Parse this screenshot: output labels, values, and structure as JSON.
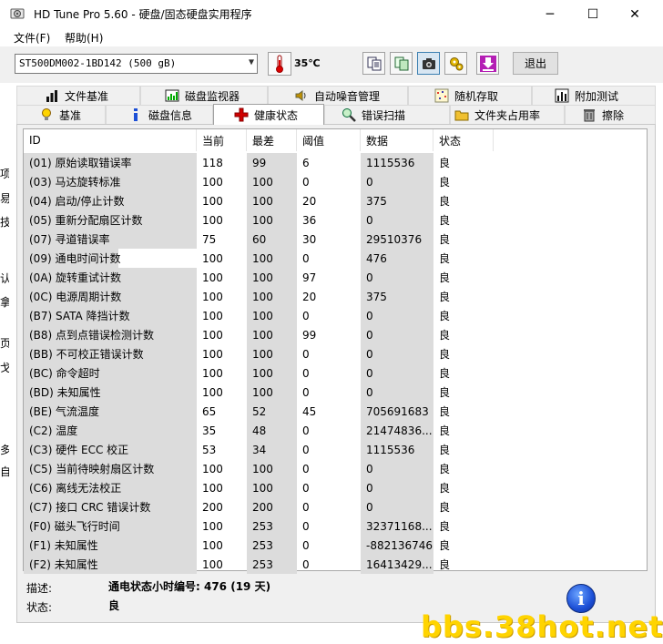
{
  "window": {
    "title": "HD Tune Pro 5.60 - 硬盘/固态硬盘实用程序",
    "minimize": "─",
    "maximize": "☐",
    "close": "✕"
  },
  "menu": [
    "文件(F)",
    "帮助(H)"
  ],
  "toolbar": {
    "drive": "ST500DM002-1BD142 (500 gB)",
    "temperature": "35℃",
    "exit_label": "退出"
  },
  "tabs_top": [
    "文件基准",
    "磁盘监视器",
    "自动噪音管理",
    "随机存取",
    "附加测试"
  ],
  "tabs_bottom": [
    "基准",
    "磁盘信息",
    "健康状态",
    "错误扫描",
    "文件夹占用率",
    "擦除"
  ],
  "table": {
    "columns": [
      "ID",
      "当前",
      "最差",
      "阈值",
      "数据",
      "状态"
    ],
    "rows": [
      [
        "(01) 原始读取错误率",
        "118",
        "99",
        "6",
        "1115536",
        "良"
      ],
      [
        "(03) 马达旋转标准",
        "100",
        "100",
        "0",
        "0",
        "良"
      ],
      [
        "(04) 启动/停止计数",
        "100",
        "100",
        "20",
        "375",
        "良"
      ],
      [
        "(05) 重新分配扇区计数",
        "100",
        "100",
        "36",
        "0",
        "良"
      ],
      [
        "(07) 寻道错误率",
        "75",
        "60",
        "30",
        "29510376",
        "良"
      ],
      [
        "(09) 通电时间计数",
        "100",
        "100",
        "0",
        "476",
        "良"
      ],
      [
        "(0A) 旋转重试计数",
        "100",
        "100",
        "97",
        "0",
        "良"
      ],
      [
        "(0C) 电源周期计数",
        "100",
        "100",
        "20",
        "375",
        "良"
      ],
      [
        "(B7) SATA 降挡计数",
        "100",
        "100",
        "0",
        "0",
        "良"
      ],
      [
        "(B8) 点到点错误检测计数",
        "100",
        "100",
        "99",
        "0",
        "良"
      ],
      [
        "(BB) 不可校正错误计数",
        "100",
        "100",
        "0",
        "0",
        "良"
      ],
      [
        "(BC) 命令超时",
        "100",
        "100",
        "0",
        "0",
        "良"
      ],
      [
        "(BD) 未知属性",
        "100",
        "100",
        "0",
        "0",
        "良"
      ],
      [
        "(BE) 气流温度",
        "65",
        "52",
        "45",
        "705691683",
        "良"
      ],
      [
        "(C2) 温度",
        "35",
        "48",
        "0",
        "21474836...",
        "良"
      ],
      [
        "(C3) 硬件 ECC 校正",
        "53",
        "34",
        "0",
        "1115536",
        "良"
      ],
      [
        "(C5) 当前待映射扇区计数",
        "100",
        "100",
        "0",
        "0",
        "良"
      ],
      [
        "(C6) 离线无法校正",
        "100",
        "100",
        "0",
        "0",
        "良"
      ],
      [
        "(C7) 接口 CRC 错误计数",
        "200",
        "200",
        "0",
        "0",
        "良"
      ],
      [
        "(F0) 磁头飞行时间",
        "100",
        "253",
        "0",
        "32371168...",
        "良"
      ],
      [
        "(F1) 未知属性",
        "100",
        "253",
        "0",
        "-882136746",
        "良"
      ],
      [
        "(F2) 未知属性",
        "100",
        "253",
        "0",
        "16413429...",
        "良"
      ]
    ]
  },
  "footer": {
    "desc_label": "描述:",
    "desc_value": "通电状态小时编号: 476 (19 天)",
    "status_label": "状态:",
    "status_value": "良",
    "info_glyph": "i"
  },
  "left_fragments": [
    "项",
    "易",
    "技",
    "认",
    "拿",
    "页",
    "戈",
    "多",
    "自"
  ],
  "watermark": "bbs.38hot.net"
}
